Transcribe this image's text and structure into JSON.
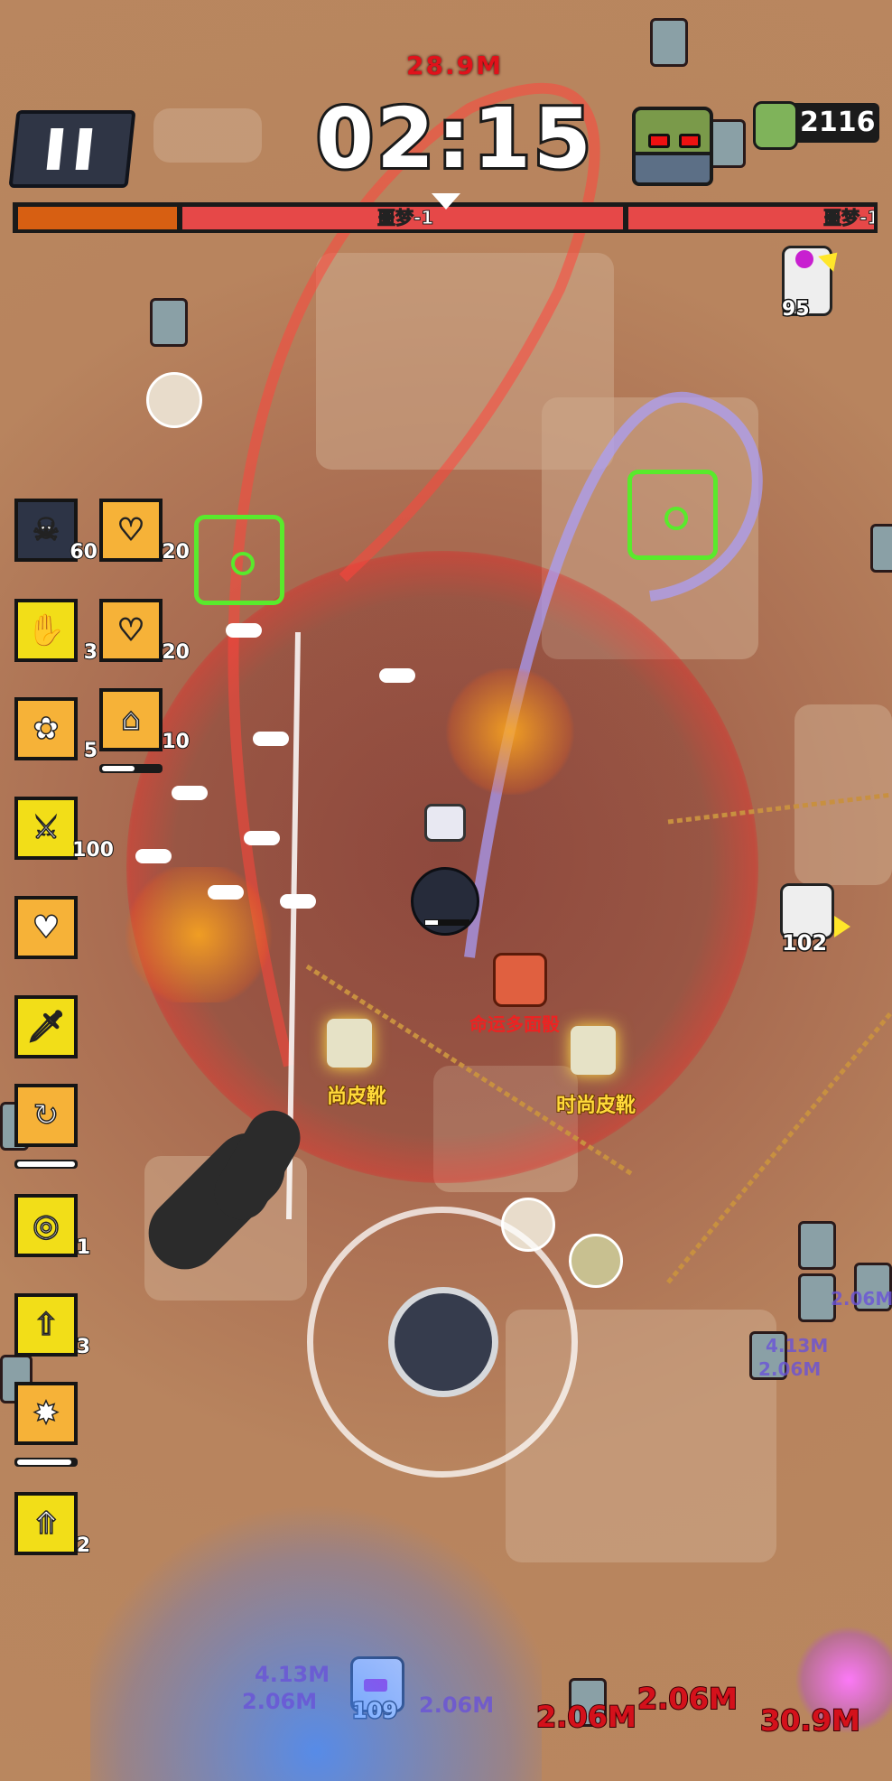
{
  "hud": {
    "top_damage": "28.9M",
    "timer": "02:15",
    "kill_count": "2116",
    "stage_label_1": "噩梦-1",
    "stage_label_2": "噩梦-1",
    "stage_progress": 0.19
  },
  "skills": {
    "left_column": [
      {
        "icon": "skull-chain-icon",
        "count": "60",
        "style": "dark"
      },
      {
        "icon": "hand-card-icon",
        "count": "3",
        "style": "yellow"
      },
      {
        "icon": "rose-card-icon",
        "count": "5",
        "style": "orange"
      },
      {
        "icon": "crossed-swords-icon",
        "count": "100",
        "style": "yellow"
      },
      {
        "icon": "heart-shield-icon",
        "count": "",
        "style": "orange"
      },
      {
        "icon": "sword-icon",
        "count": "",
        "style": "yellow"
      },
      {
        "icon": "refresh-arrow-icon",
        "count": "",
        "style": "orange",
        "cooldown": 1.0
      },
      {
        "icon": "coin-icon",
        "count": "1",
        "style": "yellow"
      },
      {
        "icon": "tower-up-icon",
        "count": "3",
        "style": "yellow"
      },
      {
        "icon": "burst-timer-icon",
        "count": "",
        "style": "orange",
        "cooldown": 0.95
      },
      {
        "icon": "magnet-up-icon",
        "count": "2",
        "style": "yellow"
      }
    ],
    "right_column": [
      {
        "icon": "heart-eye-icon",
        "count": "20",
        "style": "orange"
      },
      {
        "icon": "heart-eye-icon",
        "count": "20",
        "style": "orange"
      },
      {
        "icon": "house-clock-icon",
        "count": "10",
        "style": "orange",
        "cooldown": 0.55
      }
    ]
  },
  "field": {
    "item_label_1": "时尚皮靴",
    "item_label_2": "时尚皮靴",
    "partial_label": "尚皮靴",
    "dice_label": "命运多面骰",
    "offscreen_count_1": "95",
    "offscreen_count_2": "102",
    "chest_count": "109",
    "damage_numbers": [
      "2.06M",
      "2.06M",
      "2.06M",
      "30.9M",
      "4.13M",
      "2.06M",
      "2.06M",
      "4.13M",
      "2.06M"
    ]
  },
  "colors": {
    "progress_fill": "#d75f12",
    "progress_track": "#e64848",
    "damage_red": "#d4111b",
    "skill_orange": "#f6b238",
    "skill_yellow": "#f2de18"
  }
}
